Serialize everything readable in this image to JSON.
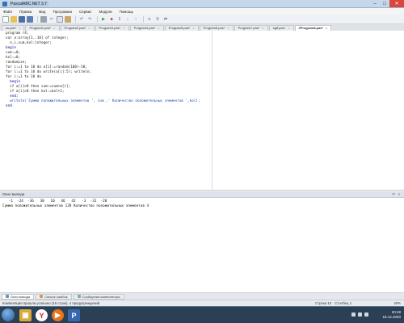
{
  "window": {
    "title": "PascalABC.NET 3.7",
    "controls": {
      "minimize": "–",
      "maximize": "□",
      "close": "✕"
    }
  },
  "menu": [
    "Файл",
    "Правка",
    "Вид",
    "Программа",
    "Сервис",
    "Модули",
    "Помощь"
  ],
  "toolbar_icons": [
    "new-file-icon",
    "open-folder-icon",
    "save-icon",
    "save-all-icon",
    "print-icon",
    "cut-icon",
    "copy-icon",
    "paste-icon",
    "undo-icon",
    "redo-icon",
    "run-icon",
    "stop-icon",
    "debug-step-icon",
    "debug-step-into-icon",
    "debug-step-out-icon",
    "format-icon",
    "find-icon",
    "replace-icon"
  ],
  "tabs": [
    {
      "label": "ss.pas*",
      "active": false
    },
    {
      "label": "Program1.pas*",
      "active": false
    },
    {
      "label": "Program2.pas*",
      "active": false
    },
    {
      "label": "Program3.pas*",
      "active": false
    },
    {
      "label": "Program4.pas*",
      "active": false
    },
    {
      "label": "Program5.pas*",
      "active": false
    },
    {
      "label": "Program6.pas*",
      "active": false
    },
    {
      "label": "Program7.pas*",
      "active": false
    },
    {
      "label": "sgff.pas*",
      "active": false
    },
    {
      "label": "#Program8.pas*",
      "active": true
    }
  ],
  "code_lines": [
    "program r4;",
    "var a:array[1..10] of integer;",
    "  n,i,sum,kol:integer;",
    "begin",
    "sum:=0;",
    "kol:=0;",
    "randomize;",
    "for i:=1 to 10 do a[i]:=random(100)-50;",
    "for i:=1 to 10 do write(a[i]:5); writeln;",
    "for i:=1 to 10 do",
    "  begin",
    "  if a[i]>0 then sum:=sum+a[i];",
    "  if a[i]>0 then kol:=kol+1;",
    "  end;",
    "  writeln('Сумма положительных элементов ', sum ,' Количество положительных элементов ',kol);",
    "end."
  ],
  "output_panel": {
    "title": "Окно вывода",
    "lines": [
      "   -1  -24  -36   30   10   46   42   -3  -31  -20",
      "Сумма положительных элементов 128 Количество положительных элементов 4"
    ]
  },
  "bottom_tabs": [
    {
      "label": "Окно вывода",
      "active": true
    },
    {
      "label": "Список ошибок",
      "active": false
    },
    {
      "label": "Сообщения компилятора",
      "active": false
    }
  ],
  "status": {
    "message": "Компиляция прошла успешно (16 строк), 4 предупреждений",
    "line": "Строка 10",
    "column": "Столбец 1",
    "zoom": "40%"
  },
  "taskbar": {
    "apps": [
      "explorer-icon",
      "yandex-browser-icon",
      "media-player-icon",
      "pascalabc-icon"
    ],
    "time": "20:48",
    "date": "18.12.2020"
  }
}
